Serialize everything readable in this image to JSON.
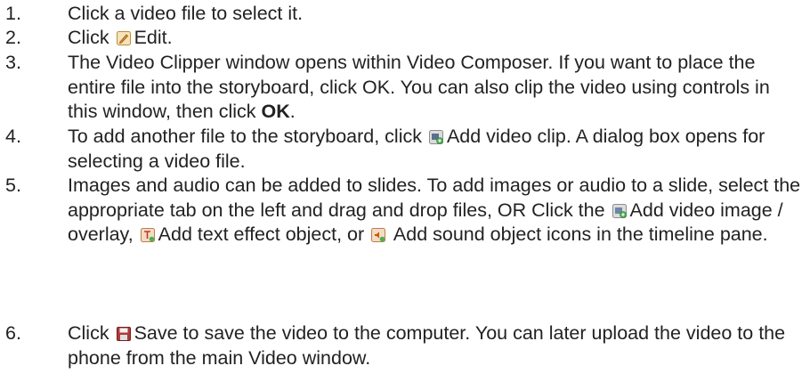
{
  "steps": [
    {
      "num": "1.",
      "parts": [
        {
          "t": "Click a video file to select it."
        }
      ]
    },
    {
      "num": "2.",
      "parts": [
        {
          "t": "Click "
        },
        {
          "icon": "edit-icon"
        },
        {
          "t": "Edit."
        }
      ]
    },
    {
      "num": "3.",
      "parts": [
        {
          "t": "The Video Clipper window opens within Video Composer. If you want to place the entire file into the storyboard, click OK. You can also clip the video using controls in this window, then click "
        },
        {
          "b": "OK"
        },
        {
          "t": "."
        }
      ]
    },
    {
      "num": "4.",
      "parts": [
        {
          "t": "To add another file to the storyboard, click "
        },
        {
          "icon": "add-video-clip-icon"
        },
        {
          "t": "Add video clip. A dialog box opens for selecting a video file."
        }
      ]
    },
    {
      "num": "5.",
      "parts": [
        {
          "t": "Images and audio can be added to slides. To add images or audio to a slide, select the appropriate tab on the left and drag and drop files, OR Click the "
        },
        {
          "icon": "add-video-image-overlay-icon"
        },
        {
          "t": "Add video image / overlay, "
        },
        {
          "icon": "add-text-effect-icon"
        },
        {
          "t": "Add text effect object, or "
        },
        {
          "icon": "add-sound-object-icon"
        },
        {
          "t": " Add sound object icons in the timeline pane."
        }
      ]
    },
    {
      "num": "6.",
      "parts": [
        {
          "t": "Click "
        },
        {
          "icon": "save-icon"
        },
        {
          "t": "Save to save the video to the computer. You can later upload the video to the phone from the main Video window."
        }
      ]
    }
  ]
}
